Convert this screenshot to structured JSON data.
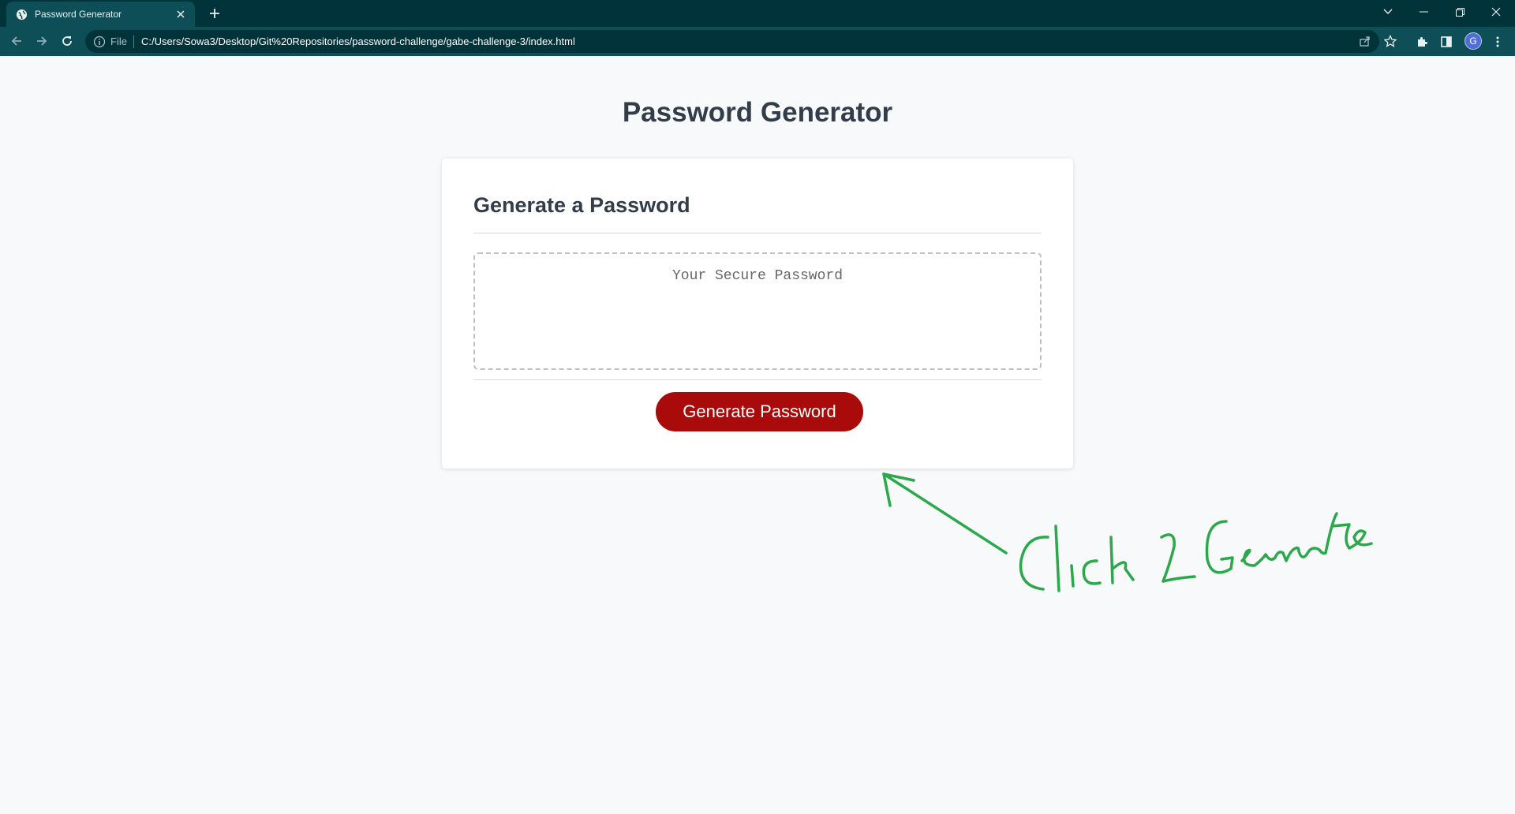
{
  "browser": {
    "tab_title": "Password Generator",
    "url_scheme": "File",
    "url": "C:/Users/Sowa3/Desktop/Git%20Repositories/password-challenge/gabe-challenge-3/index.html",
    "profile_initial": "G"
  },
  "page": {
    "title": "Password Generator",
    "card_title": "Generate a Password",
    "password_placeholder": "Your Secure Password",
    "generate_button": "Generate Password"
  },
  "annotation": {
    "text": "Click 2 Generate",
    "color": "#2aa84a"
  }
}
